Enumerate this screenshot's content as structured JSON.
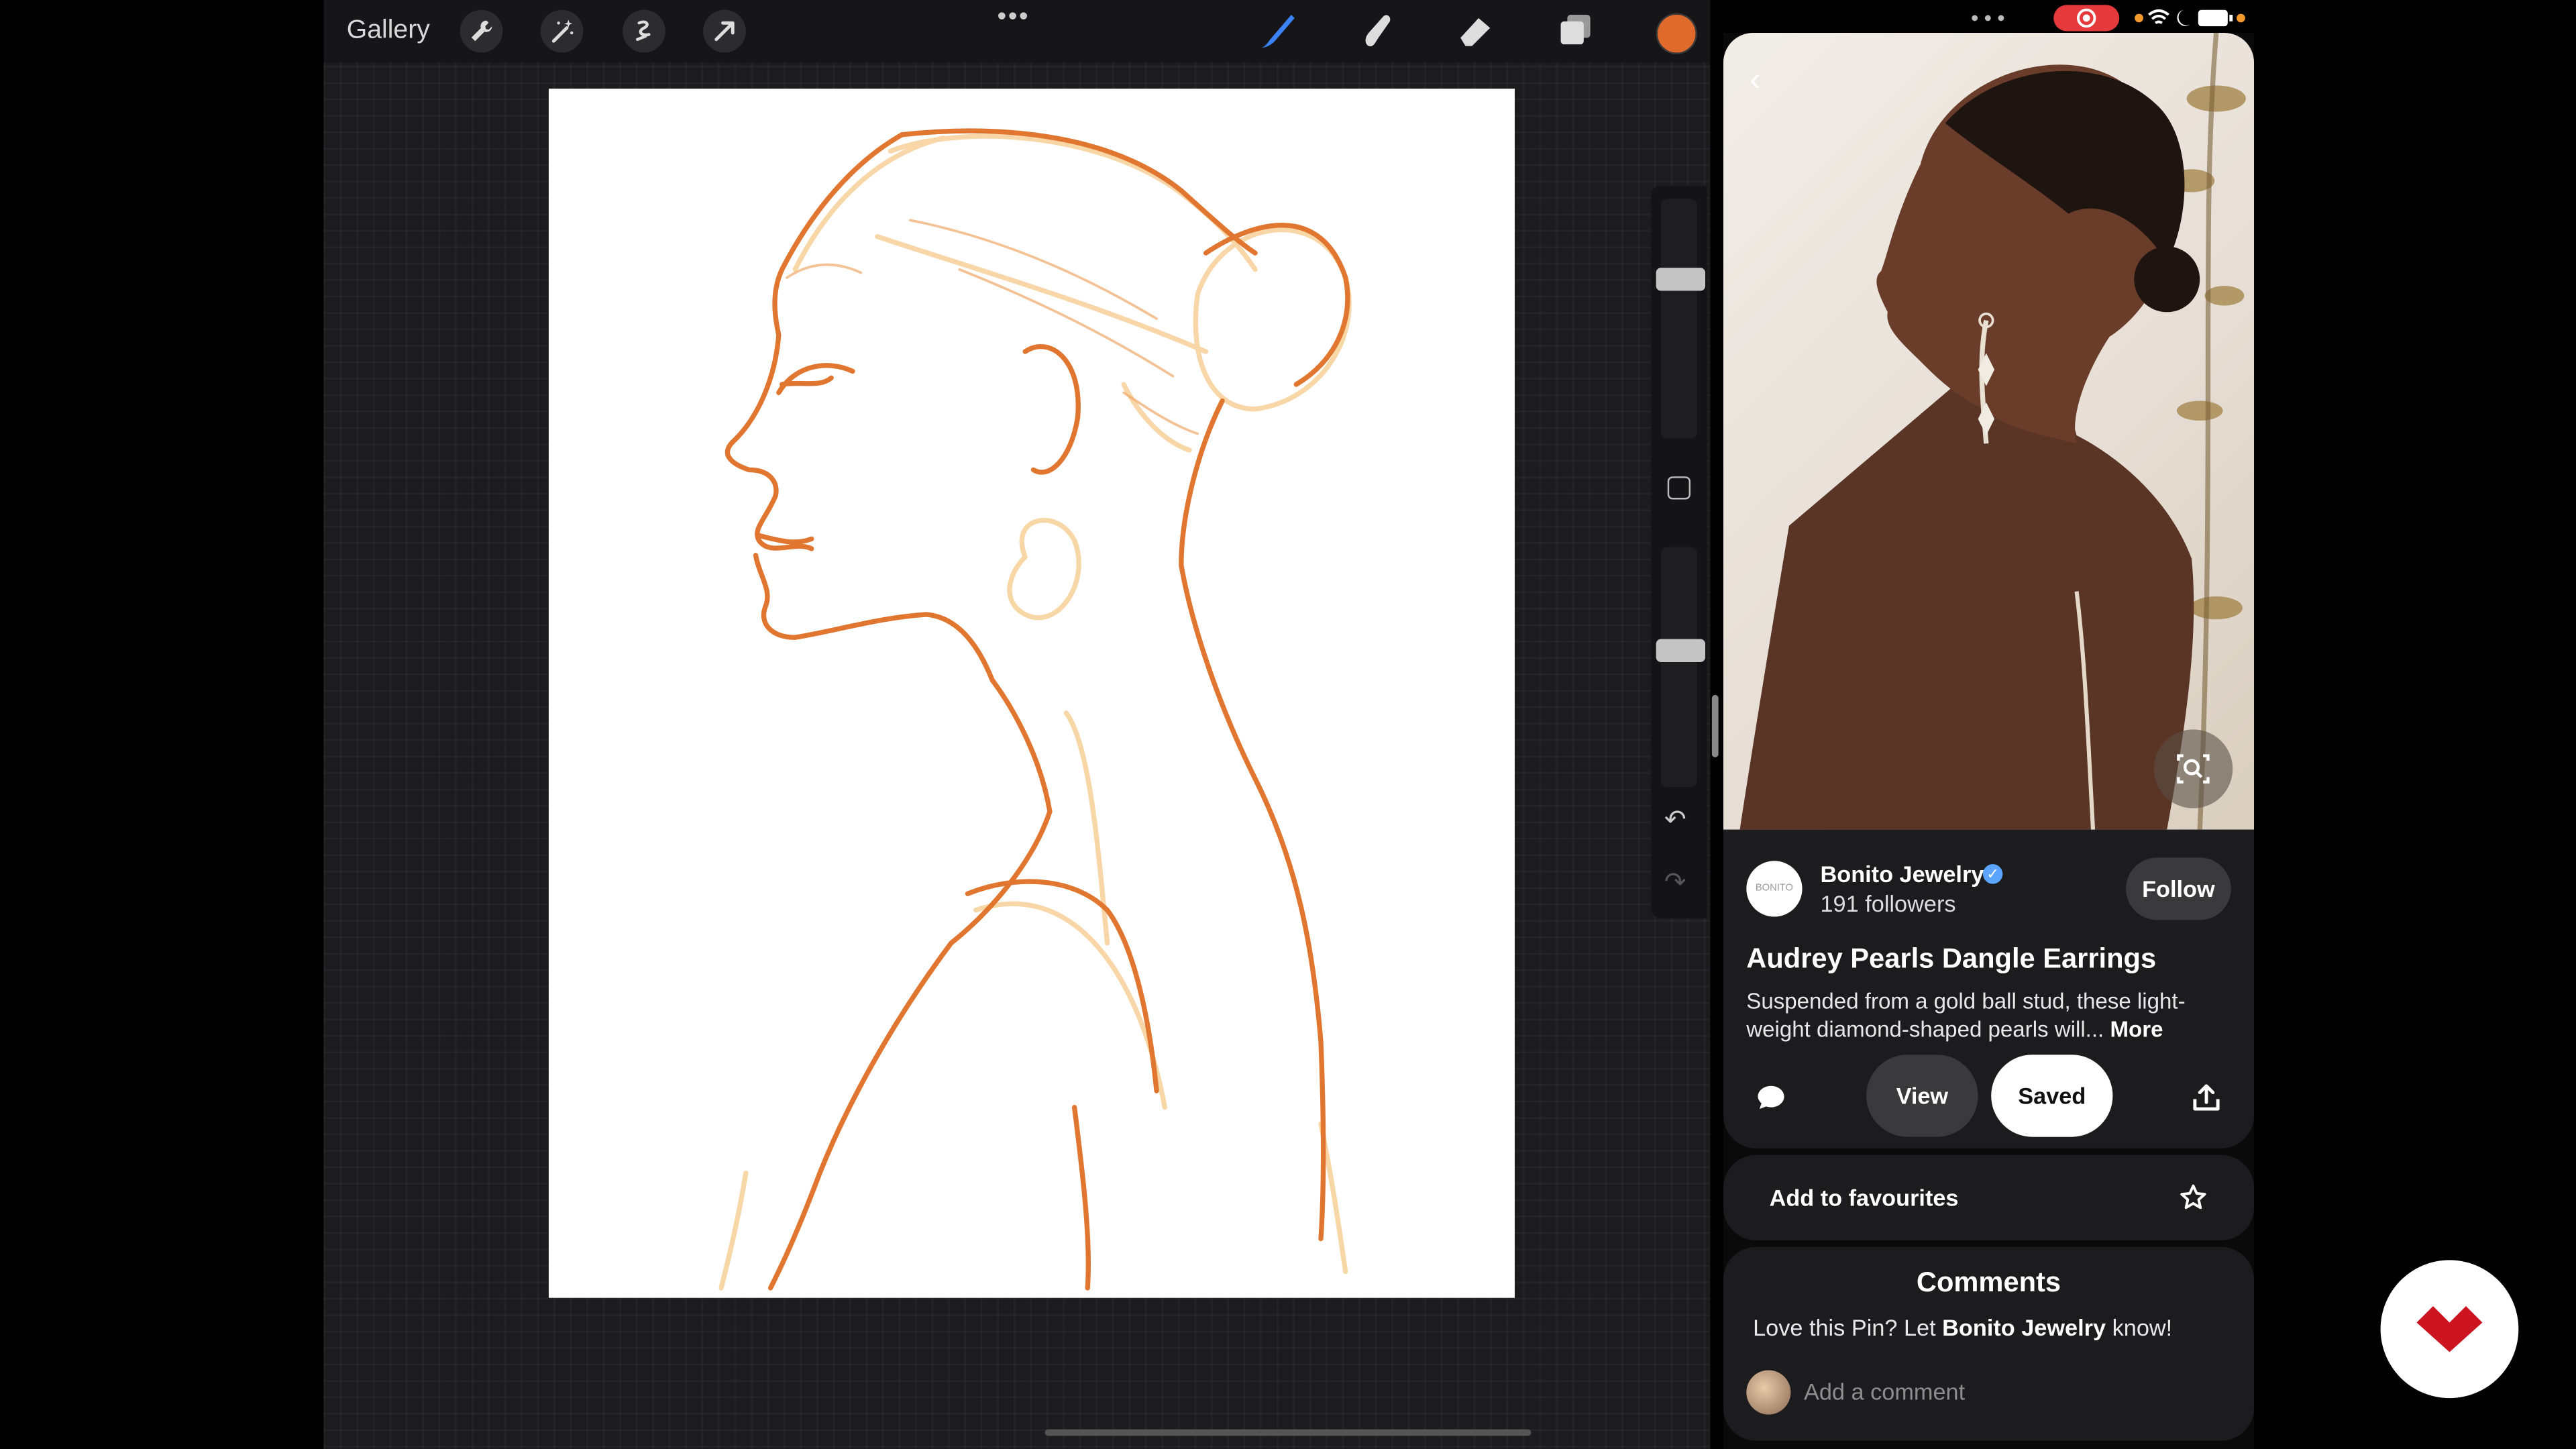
{
  "procreate": {
    "gallery_label": "Gallery",
    "more_dots": "•••",
    "current_color": "#e06a2b",
    "tools": [
      "wrench-icon",
      "magic-wand-icon",
      "selection-icon",
      "transform-arrow-icon"
    ],
    "right_tools": [
      "brush-icon",
      "smudge-icon",
      "eraser-icon",
      "layers-icon"
    ],
    "brush_size_level": 0.63,
    "opacity_level": 0.56
  },
  "pinterest": {
    "back_icon": "chevron-left-icon",
    "visual_search_icon": "lens-search-icon",
    "brand": "Bonito Jewelry",
    "avatar_text": "BONITO",
    "followers": "191 followers",
    "follow_label": "Follow",
    "title": "Audrey Pearls Dangle Earrings",
    "description": "Suspended from a gold ball stud, these light-weight diamond-shaped pearls will...",
    "more_label": "More",
    "view_label": "View",
    "saved_label": "Saved",
    "favourites_label": "Add to favourites",
    "comments_title": "Comments",
    "comments_prompt_prefix": "Love this Pin? Let ",
    "comments_prompt_brand": "Bonito Jewelry",
    "comments_prompt_suffix": " know!",
    "add_comment_placeholder": "Add a comment"
  },
  "colors": {
    "accent_red": "#e60023",
    "sketch_orange": "#e0762f"
  }
}
